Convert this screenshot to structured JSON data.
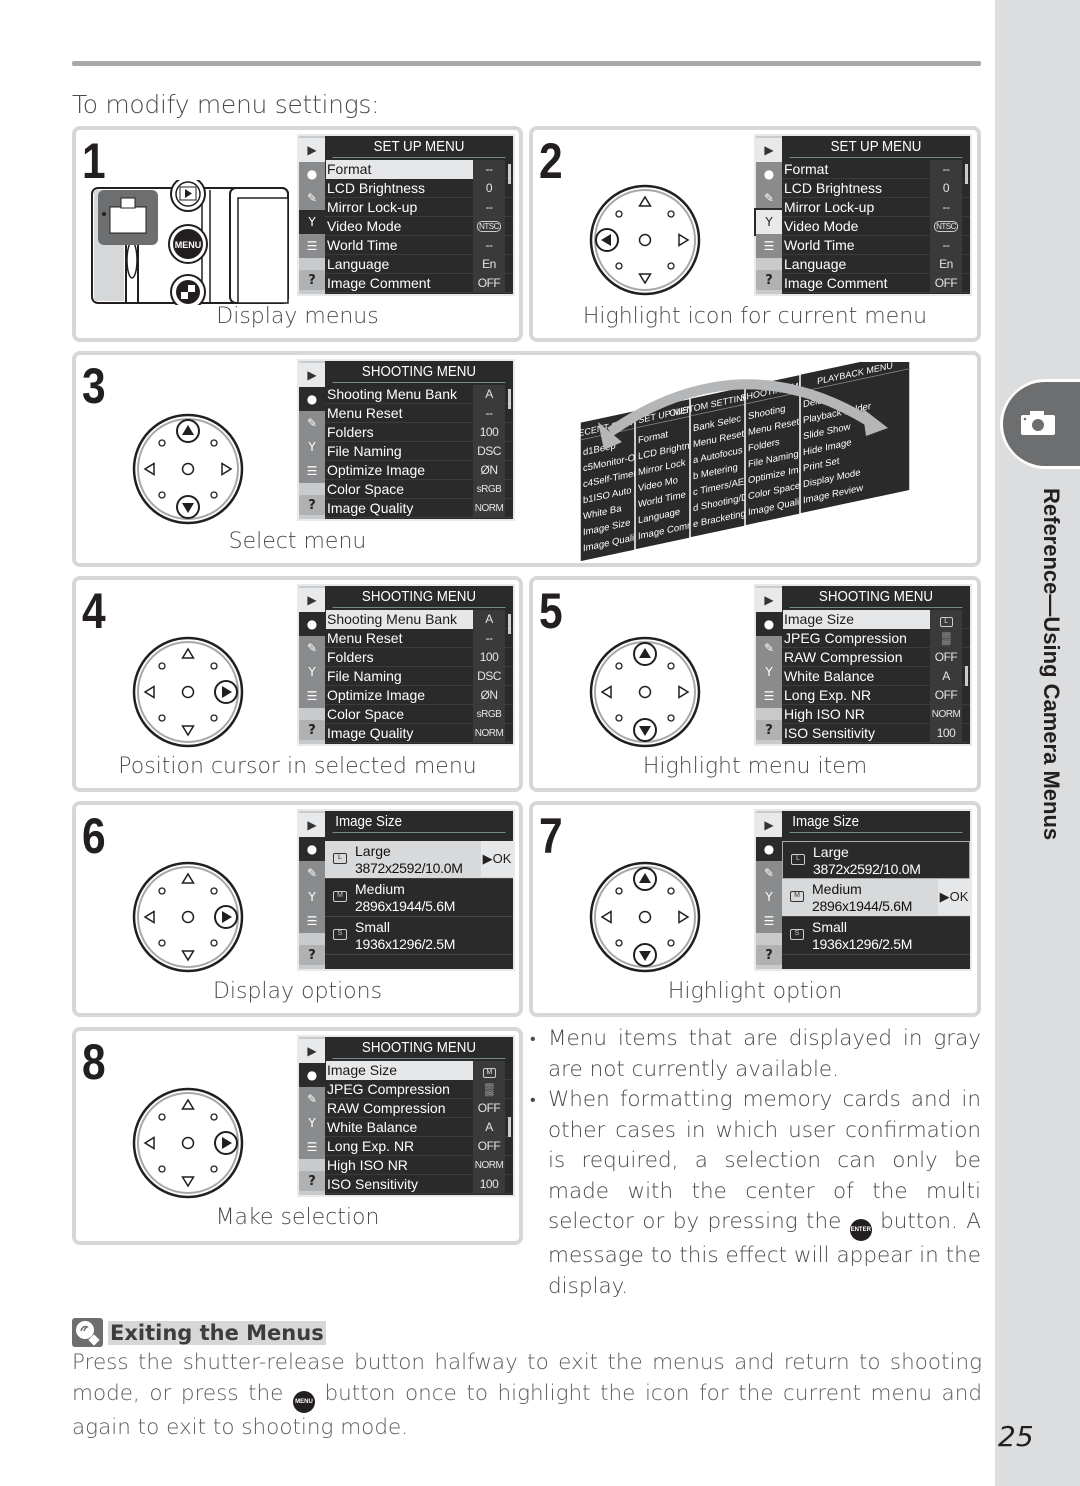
{
  "page": {
    "intro": "To modify menu settings:",
    "page_number": "25",
    "side_title": "Reference—Using Camera Menus",
    "side_tab_icon": "camera-icon"
  },
  "steps": [
    {
      "number": "1",
      "caption": "Display menus",
      "illustration": "camera-back-menu-button",
      "button_labels": [
        "MENU"
      ],
      "screen": {
        "title": "SET UP MENU",
        "active_tab": "setup",
        "highlighted_item": 0,
        "items": [
          {
            "label": "Format",
            "value": "--"
          },
          {
            "label": "LCD Brightness",
            "value": "0"
          },
          {
            "label": "Mirror Lock-up",
            "value": "--"
          },
          {
            "label": "Video Mode",
            "value": "NTSC"
          },
          {
            "label": "World Time",
            "value": "--"
          },
          {
            "label": "Language",
            "value": "En"
          },
          {
            "label": "Image Comment",
            "value": "OFF"
          }
        ]
      }
    },
    {
      "number": "2",
      "caption": "Highlight icon for current menu",
      "selector_pressed": "left",
      "screen": {
        "title": "SET UP MENU",
        "active_tab": "setup-outlined",
        "highlighted_item": null,
        "items": [
          {
            "label": "Format",
            "value": "--"
          },
          {
            "label": "LCD Brightness",
            "value": "0"
          },
          {
            "label": "Mirror Lock-up",
            "value": "--"
          },
          {
            "label": "Video Mode",
            "value": "NTSC"
          },
          {
            "label": "World Time",
            "value": "--"
          },
          {
            "label": "Language",
            "value": "En"
          },
          {
            "label": "Image Comment",
            "value": "OFF"
          }
        ]
      }
    },
    {
      "number": "3",
      "caption": "Select menu",
      "selector_pressed": "up-down",
      "screen": {
        "title": "SHOOTING MENU",
        "active_tab": "shooting",
        "highlighted_item": null,
        "items": [
          {
            "label": "Shooting Menu Bank",
            "value": "A"
          },
          {
            "label": "Menu Reset",
            "value": "--"
          },
          {
            "label": "Folders",
            "value": "100"
          },
          {
            "label": "File Naming",
            "value": "DSC"
          },
          {
            "label": "Optimize Image",
            "value": "ØN"
          },
          {
            "label": "Color Space",
            "value": "sRGB"
          },
          {
            "label": "Image Quality",
            "value": "NORM"
          }
        ]
      },
      "stack_menus": [
        {
          "title": "RECENT SETTINGS",
          "items": [
            "d1Beep",
            "c5Monitor-O",
            "c4Self-Timer",
            "b1ISO Auto",
            "White Ba",
            "Image Size",
            "Image Quality"
          ]
        },
        {
          "title": "SET UP MENU",
          "items": [
            "Format",
            "LCD Brightne",
            "Mirror Lock",
            "Video Mo",
            "World Time",
            "Language",
            "Image Comm"
          ]
        },
        {
          "title": "CUSTOM SETTING MENU",
          "items": [
            "Bank Selec",
            "Menu Reset",
            "a Autofocus",
            "b Metering",
            "c Timers/AE",
            "d Shooting/D",
            "e Bracketing"
          ]
        },
        {
          "title": "SHOOTING MENU",
          "items": [
            "Shooting",
            "Menu Reset",
            "Folders",
            "File Naming",
            "Optimize Ima",
            "Color Space",
            "Image Qualit"
          ]
        },
        {
          "title": "PLAYBACK MENU",
          "items": [
            "Delete",
            "Playback Folder",
            "Slide Show",
            "Hide Image",
            "Print Set",
            "Display Mode",
            "Image Review"
          ]
        }
      ]
    },
    {
      "number": "4",
      "caption": "Position cursor in selected menu",
      "selector_pressed": "right",
      "screen": {
        "title": "SHOOTING MENU",
        "active_tab": "shooting",
        "highlighted_item": 0,
        "items": [
          {
            "label": "Shooting Menu Bank",
            "value": "A"
          },
          {
            "label": "Menu Reset",
            "value": "--"
          },
          {
            "label": "Folders",
            "value": "100"
          },
          {
            "label": "File Naming",
            "value": "DSC"
          },
          {
            "label": "Optimize Image",
            "value": "ØN"
          },
          {
            "label": "Color Space",
            "value": "sRGB"
          },
          {
            "label": "Image Quality",
            "value": "NORM"
          }
        ]
      }
    },
    {
      "number": "5",
      "caption": "Highlight menu item",
      "selector_pressed": "up-down",
      "screen": {
        "title": "SHOOTING MENU",
        "active_tab": "shooting",
        "highlighted_item": 0,
        "items": [
          {
            "label": "Image Size",
            "value": "L"
          },
          {
            "label": "JPEG Compression",
            "value": "▒"
          },
          {
            "label": "RAW Compression",
            "value": "OFF"
          },
          {
            "label": "White Balance",
            "value": "A"
          },
          {
            "label": "Long Exp. NR",
            "value": "OFF"
          },
          {
            "label": "High ISO NR",
            "value": "NORM"
          },
          {
            "label": "ISO Sensitivity",
            "value": "100"
          }
        ]
      }
    },
    {
      "number": "6",
      "caption": "Display options",
      "selector_pressed": "right",
      "screen": {
        "title": "Image Size",
        "active_tab": "shooting",
        "highlighted_option": 0,
        "ok_label": "▶OK",
        "options": [
          {
            "icon": "L",
            "name": "Large",
            "detail": "3872x2592/10.0M"
          },
          {
            "icon": "M",
            "name": "Medium",
            "detail": "2896x1944/5.6M"
          },
          {
            "icon": "S",
            "name": "Small",
            "detail": "1936x1296/2.5M"
          }
        ]
      }
    },
    {
      "number": "7",
      "caption": "Highlight option",
      "selector_pressed": "up-down",
      "screen": {
        "title": "Image Size",
        "active_tab": "shooting",
        "highlighted_option": 1,
        "ok_label": "▶OK",
        "options": [
          {
            "icon": "L",
            "name": "Large",
            "detail": "3872x2592/10.0M"
          },
          {
            "icon": "M",
            "name": "Medium",
            "detail": "2896x1944/5.6M"
          },
          {
            "icon": "S",
            "name": "Small",
            "detail": "1936x1296/2.5M"
          }
        ]
      }
    },
    {
      "number": "8",
      "caption": "Make selection",
      "selector_pressed": "right",
      "screen": {
        "title": "SHOOTING MENU",
        "active_tab": "shooting",
        "highlighted_item": 0,
        "items": [
          {
            "label": "Image Size",
            "value": "M"
          },
          {
            "label": "JPEG Compression",
            "value": "▒"
          },
          {
            "label": "RAW Compression",
            "value": "OFF"
          },
          {
            "label": "White Balance",
            "value": "A"
          },
          {
            "label": "Long Exp. NR",
            "value": "OFF"
          },
          {
            "label": "High ISO NR",
            "value": "NORM"
          },
          {
            "label": "ISO Sensitivity",
            "value": "100"
          }
        ]
      }
    }
  ],
  "bullets": {
    "b1": "Menu items that are displayed in gray are not currently available.",
    "b2_before": "When formatting memory cards and in other cases in which user confirmation is required, a selection can only be made with the center of the multi selector or by pressing the ",
    "b2_button": "ENTER",
    "b2_after": " button.  A message to this effect will appear in the display."
  },
  "note": {
    "icon": "tip-icon",
    "title": "Exiting the Menus",
    "body_before": "Press the shutter-release button halfway to exit the menus and return to shooting mode, or press the ",
    "body_button": "MENU",
    "body_after": " button once to highlight the icon for the current menu and again to exit to shooting mode."
  }
}
